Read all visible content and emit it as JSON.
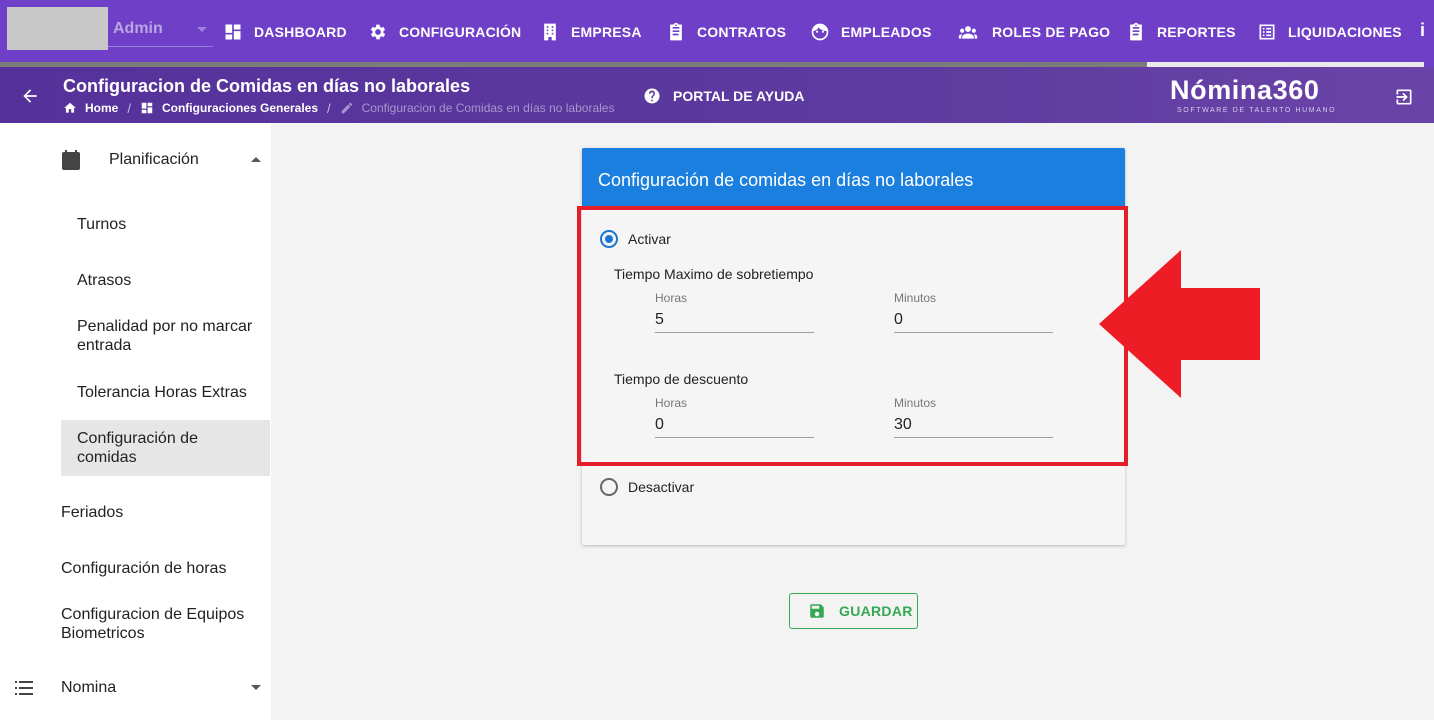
{
  "topnav": {
    "user": "Admin",
    "items": [
      {
        "label": "DASHBOARD",
        "icon": "dashboard-icon"
      },
      {
        "label": "CONFIGURACIÓN",
        "icon": "gear-icon"
      },
      {
        "label": "EMPRESA",
        "icon": "building-icon"
      },
      {
        "label": "CONTRATOS",
        "icon": "clipboard-icon"
      },
      {
        "label": "EMPLEADOS",
        "icon": "face-icon"
      },
      {
        "label": "ROLES DE PAGO",
        "icon": "people-icon"
      },
      {
        "label": "REPORTES",
        "icon": "clipboard-list-icon"
      },
      {
        "label": "LIQUIDACIONES",
        "icon": "list-box-icon"
      }
    ],
    "more": "i",
    "progress_fraction": 0.8
  },
  "subheader": {
    "title": "Configuracion de Comidas en días no laborales",
    "breadcrumbs": [
      {
        "label": "Home",
        "icon": "home-icon"
      },
      {
        "label": "Configuraciones Generales",
        "icon": "dashboard-icon"
      },
      {
        "label": "Configuracion de Comidas en días no laborales",
        "icon": "pencil-icon"
      }
    ],
    "help": "PORTAL DE AYUDA",
    "brand_name": "Nómina360",
    "brand_tag": "SOFTWARE DE TALENTO HUMANO"
  },
  "sidebar": {
    "planificacion": "Planificación",
    "sub_items": [
      "Turnos",
      "Atrasos",
      "Penalidad por no marcar entrada",
      "Tolerancia Horas Extras",
      "Configuración de comidas"
    ],
    "items": [
      "Feriados",
      "Configuración de horas",
      "Configuracion de Equipos Biometricos"
    ],
    "nomina": "Nomina"
  },
  "card": {
    "title": "Configuración de comidas en días no laborales",
    "activar": "Activar",
    "desactivar": "Desactivar",
    "group1": {
      "title": "Tiempo Maximo de sobretiempo",
      "horas_label": "Horas",
      "horas_value": "5",
      "minutos_label": "Minutos",
      "minutos_value": "0"
    },
    "group2": {
      "title": "Tiempo de descuento",
      "horas_label": "Horas",
      "horas_value": "0",
      "minutos_label": "Minutos",
      "minutos_value": "30"
    }
  },
  "save_label": "GUARDAR",
  "colors": {
    "nav": "#6f3fc7",
    "card_header": "#1b7fdf",
    "highlight": "#e41f2a",
    "save": "#35a853"
  }
}
